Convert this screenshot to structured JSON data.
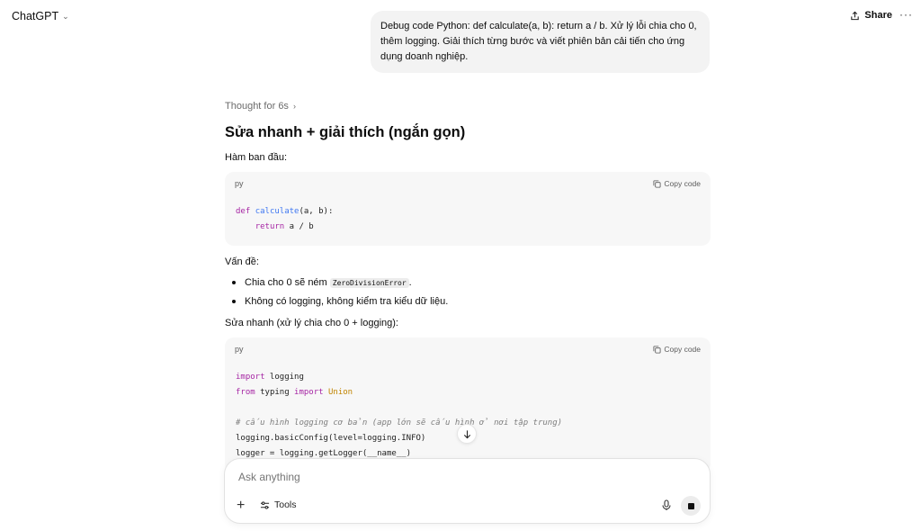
{
  "header": {
    "app_title": "ChatGPT",
    "share_label": "Share",
    "more_label": "···"
  },
  "user_message": "Debug code Python: def calculate(a, b): return a / b. Xử lý lỗi chia cho 0, thêm logging. Giải thích từng bước và viết phiên bản cải tiến cho ứng dụng doanh nghiệp.",
  "assistant": {
    "thought_label": "Thought for 6s",
    "heading": "Sửa nhanh + giải thích (ngắn gọn)",
    "intro": "Hàm ban đầu:",
    "code1": {
      "lang": "py",
      "copy_label": "Copy code",
      "line1_kw": "def",
      "line1_fn": "calculate",
      "line1_rest": "(a, b):",
      "line2_kw": "return",
      "line2_rest": " a / b"
    },
    "issues_title": "Vấn đề:",
    "issues": {
      "item1_pre": "Chia cho 0 sẽ ném ",
      "item1_code": "ZeroDivisionError",
      "item1_post": ".",
      "item2": "Không có logging, không kiểm tra kiểu dữ liệu."
    },
    "fix_title": "Sửa nhanh (xử lý chia cho 0 + logging):",
    "code2": {
      "lang": "py",
      "copy_label": "Copy code",
      "l1_kw": "import",
      "l1_rest": " logging",
      "l2_kw1": "from",
      "l2_mid": " typing ",
      "l2_kw2": "import",
      "l2_cls": "Union",
      "l4_comment": "# cấu hình logging cơ bản (app lớn sẽ cấu hình ở nơi tập trung)",
      "l5": "logging.basicConfig(level=logging.INFO)",
      "l6": "logger = logging.getLogger(__name__)"
    }
  },
  "composer": {
    "placeholder": "Ask anything",
    "tools_label": "Tools"
  }
}
